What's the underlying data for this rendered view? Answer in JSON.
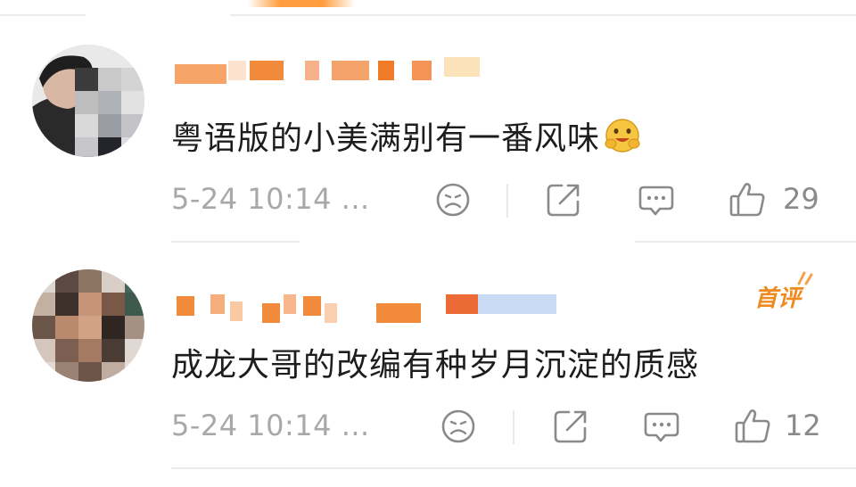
{
  "comments": [
    {
      "text": "粤语版的小美满别有一番风味",
      "emoji_icon": "hug-face-emoji-icon",
      "time": "5-24 10:14 ...",
      "like_count": "29",
      "badge": ""
    },
    {
      "text": "成龙大哥的改编有种岁月沉淀的质感",
      "emoji_icon": "",
      "time": "5-24 10:14 ...",
      "like_count": "12",
      "badge": "首评"
    }
  ],
  "colors": {
    "accent_orange": "#f08a1e",
    "text_primary": "#1d1d1d",
    "text_secondary": "#a8a8a8",
    "icon_gray": "#8a8a8a",
    "divider": "#ececec"
  },
  "icons": [
    "dislike-icon",
    "share-icon",
    "reply-icon",
    "like-icon"
  ]
}
